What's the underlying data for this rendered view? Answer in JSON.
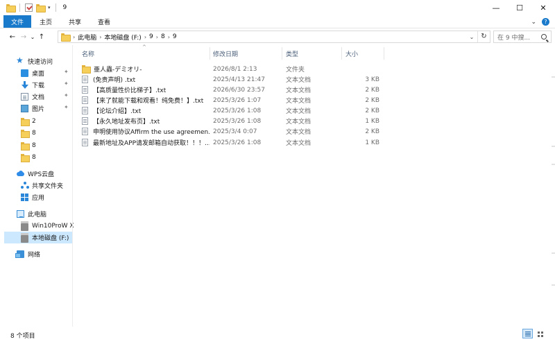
{
  "window": {
    "title": "9",
    "controls": {
      "minimize": "—",
      "maximize": "☐",
      "close": "✕"
    }
  },
  "ribbon": {
    "tabs": [
      "文件",
      "主页",
      "共享",
      "查看"
    ],
    "expand": "⌄",
    "help": "?"
  },
  "nav_buttons": {
    "back": "←",
    "forward": "→",
    "recent": "⌄",
    "up": "↑"
  },
  "breadcrumb": [
    "此电脑",
    "本地磁盘 (F:)",
    "9",
    "8",
    "9"
  ],
  "breadcrumb_sep": "›",
  "address_dropdown": "⌄",
  "refresh": "↻",
  "search": {
    "placeholder": "在 9 中搜..."
  },
  "sidebar": {
    "quick_access": "快速访问",
    "pinned": [
      {
        "label": "桌面",
        "icon": "desktop-icon"
      },
      {
        "label": "下载",
        "icon": "download-icon"
      },
      {
        "label": "文档",
        "icon": "documents-icon"
      },
      {
        "label": "图片",
        "icon": "pictures-icon"
      }
    ],
    "pin_glyph": "✦",
    "recent_folders": [
      "2",
      "8",
      "8",
      "8"
    ],
    "wps_cloud": "WPS云盘",
    "shared_folder": "共享文件夹",
    "apps": "应用",
    "this_pc": "此电脑",
    "drives": [
      "Win10ProW X",
      "本地磁盘 (F:)"
    ],
    "network": "网络"
  },
  "columns": {
    "name": "名称",
    "date": "修改日期",
    "type": "类型",
    "size": "大小"
  },
  "files": [
    {
      "name": "亜人蟲-デミオリ-",
      "date": "2026/8/1 2:13",
      "type": "文件夹",
      "size": "",
      "kind": "folder"
    },
    {
      "name": "(免责声明) .txt",
      "date": "2025/4/13 21:47",
      "type": "文本文档",
      "size": "3 KB",
      "kind": "txt"
    },
    {
      "name": "【高质量性价比梯子】.txt",
      "date": "2026/6/30 23:57",
      "type": "文本文档",
      "size": "2 KB",
      "kind": "txt"
    },
    {
      "name": "【来了就能下载和观看！纯免费！】.txt",
      "date": "2025/3/26 1:07",
      "type": "文本文档",
      "size": "2 KB",
      "kind": "txt"
    },
    {
      "name": "【论坛介绍】.txt",
      "date": "2025/3/26 1:08",
      "type": "文本文档",
      "size": "2 KB",
      "kind": "txt"
    },
    {
      "name": "【永久地址发布页】.txt",
      "date": "2025/3/26 1:08",
      "type": "文本文档",
      "size": "1 KB",
      "kind": "txt"
    },
    {
      "name": "申明使用协议Affirm the use agreemen...",
      "date": "2025/3/4 0:07",
      "type": "文本文档",
      "size": "2 KB",
      "kind": "txt"
    },
    {
      "name": "最新地址及APP请发邮箱自动获取！！！....",
      "date": "2025/3/26 1:08",
      "type": "文本文档",
      "size": "1 KB",
      "kind": "txt"
    }
  ],
  "status": {
    "item_count": "8 个项目"
  }
}
